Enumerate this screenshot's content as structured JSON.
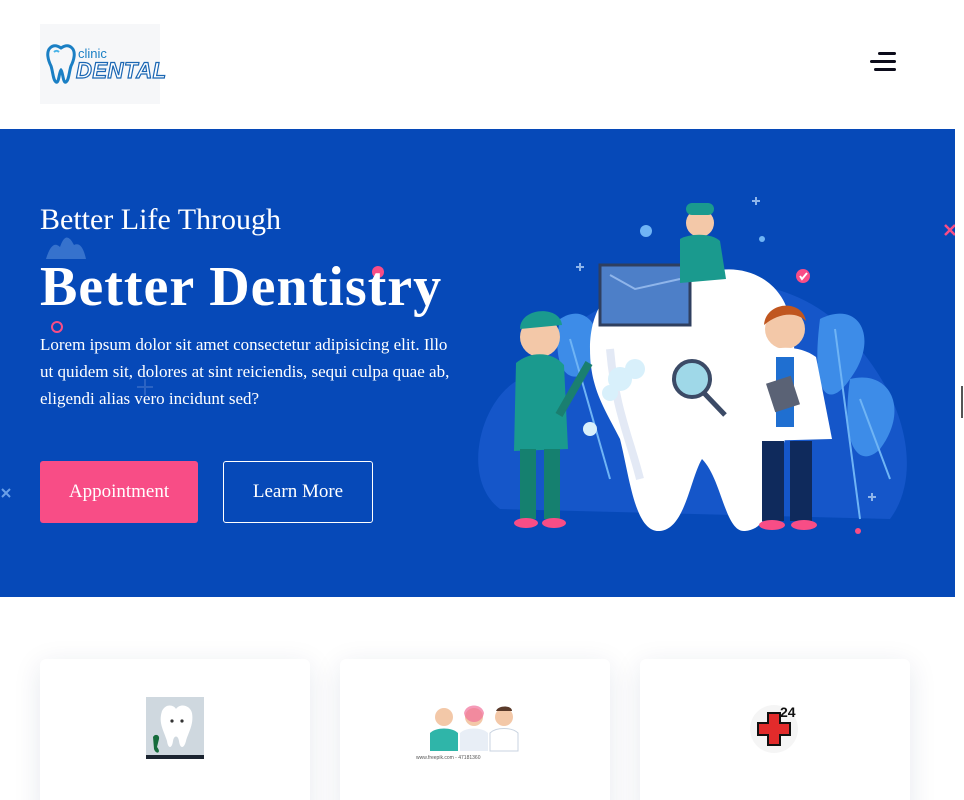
{
  "header": {
    "logo_small": "clinic",
    "logo_big": "DENTAL",
    "menu_icon": "hamburger-menu-icon"
  },
  "hero": {
    "subtitle": "Better Life Through",
    "title": "Better Dentistry",
    "description": "Lorem ipsum dolor sit amet consectetur adipisicing elit. Illo ut quidem sit, dolores at sint reiciendis, sequi culpa quae ab, eligendi alias vero incidunt sed?",
    "primary_button": "Appointment",
    "secondary_button": "Learn More",
    "illustration": "dentists-with-giant-tooth-illustration"
  },
  "cards": [
    {
      "icon": "tooth-with-phone-icon"
    },
    {
      "icon": "doctors-team-icon",
      "caption": "www.freepik.com - 47181360"
    },
    {
      "icon": "emergency-24-hours-icon",
      "badge": "24"
    }
  ],
  "colors": {
    "hero_bg": "#0649b8",
    "accent_pink": "#f84d86",
    "white": "#ffffff",
    "menu": "#0b0b1a"
  }
}
